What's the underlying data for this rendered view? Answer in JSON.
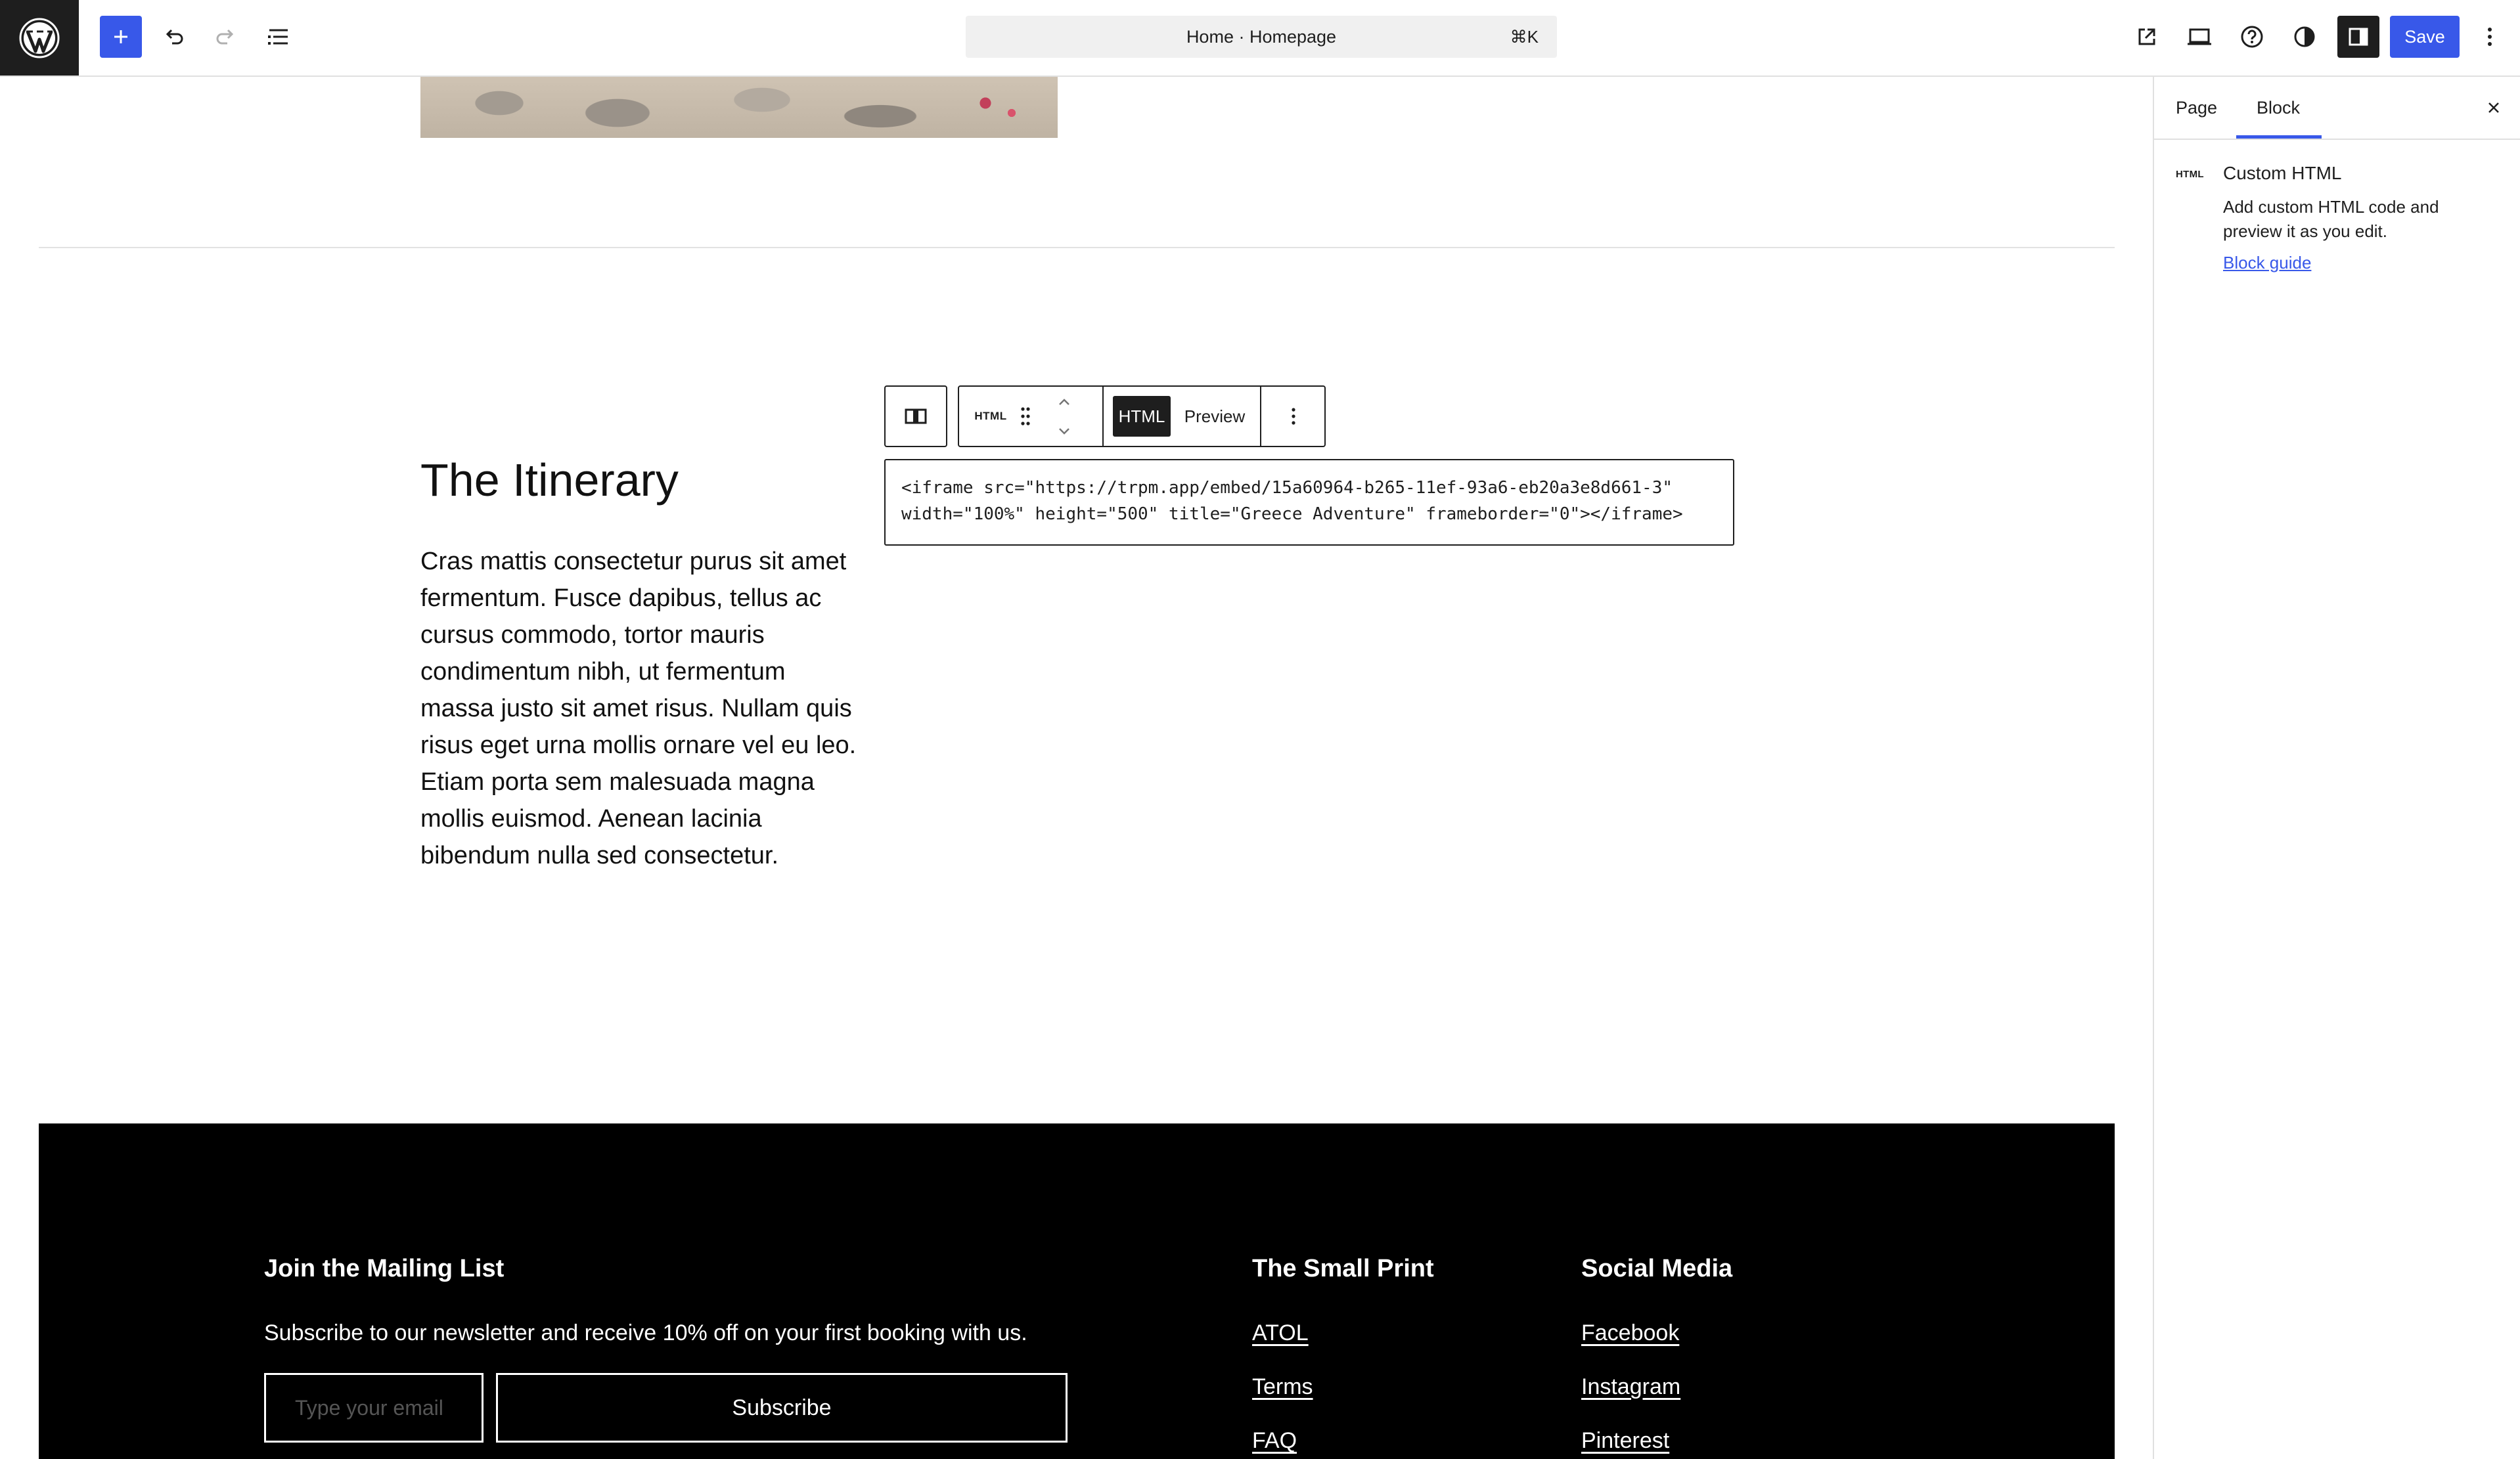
{
  "topbar": {
    "document_title": "Home · Homepage",
    "shortcut": "⌘K",
    "save_label": "Save",
    "icons": [
      "wordpress-logo",
      "plus-icon",
      "undo-icon",
      "redo-icon",
      "list-view-icon",
      "external-link-icon",
      "desktop-preview-icon",
      "help-icon",
      "contrast-icon",
      "sidebar-icon",
      "more-vertical-icon"
    ]
  },
  "content": {
    "itinerary_title": "The Itinerary",
    "itinerary_text": "Cras mattis consectetur purus sit amet fermentum. Fusce dapibus, tellus ac cursus commodo, tortor mauris condimentum nibh, ut fermentum massa justo sit amet risus. Nullam quis risus eget urna mollis ornare vel eu leo. Etiam porta sem malesuada magna mollis euismod. Aenean lacinia bibendum nulla sed consectetur."
  },
  "block_toolbar": {
    "block_label": "HTML",
    "mode_html": "HTML",
    "mode_preview": "Preview"
  },
  "code": {
    "line1": "<iframe src=\"https://trpm.app/embed/15a60964-b265-11ef-93a6-eb20a3e8d661-3\"",
    "line2": "width=\"100%\" height=\"500\" title=\"Greece Adventure\" frameborder=\"0\"></iframe>"
  },
  "footer": {
    "mailing_heading": "Join the Mailing List",
    "mailing_text": "Subscribe to our newsletter and receive 10% off on your first booking with us.",
    "email_placeholder": "Type your email",
    "subscribe_label": "Subscribe",
    "smallprint_heading": "The Small Print",
    "smallprint_links": [
      "ATOL",
      "Terms",
      "FAQ"
    ],
    "social_heading": "Social Media",
    "social_links": [
      "Facebook",
      "Instagram",
      "Pinterest"
    ]
  },
  "sidebar": {
    "tabs": [
      "Page",
      "Block"
    ],
    "active_tab": "Block",
    "block_icon_label": "HTML",
    "block_title": "Custom HTML",
    "block_description": "Add custom HTML code and preview it as you edit.",
    "block_guide_link": "Block guide"
  },
  "colors": {
    "accent": "#3858e9",
    "dark": "#1e1e1e",
    "footer_bg": "#000000"
  }
}
